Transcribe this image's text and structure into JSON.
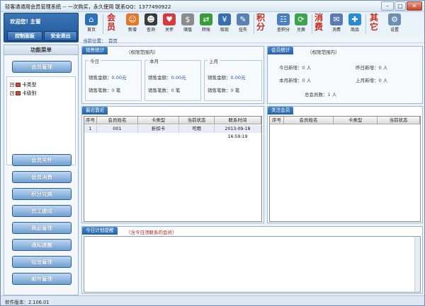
{
  "window": {
    "title": "轻客通通用会员管理系统 -- 一次购买，永久使用 联系QQ：1377490922",
    "min": "–",
    "max": "□",
    "close": "✕"
  },
  "welcome": {
    "text": "欢迎您! 主管",
    "control_panel": "控制面板",
    "logout": "安全退出"
  },
  "toolbar": {
    "items": [
      {
        "label": "首页",
        "icon": "home-icon",
        "glyph": "⌂",
        "color": "#2e6fb6"
      },
      {
        "label": "新增",
        "icon": "add-member-icon",
        "glyph": "☺",
        "color": "#e07a2a"
      },
      {
        "label": "查询",
        "icon": "search-member-icon",
        "glyph": "☻",
        "color": "#3b3b3b"
      },
      {
        "label": "关怀",
        "icon": "heart-icon",
        "glyph": "♥",
        "color": "#d63a3a"
      },
      {
        "label": "储值",
        "icon": "money-bag-icon",
        "glyph": "$",
        "color": "#8c8c8c"
      },
      {
        "label": "转账",
        "icon": "transfer-icon",
        "glyph": "⇄",
        "color": "#3a9a3a"
      },
      {
        "label": "取现",
        "icon": "cash-icon",
        "glyph": "¥",
        "color": "#3a6db0"
      },
      {
        "label": "挂失",
        "icon": "hammer-icon",
        "glyph": "✎",
        "color": "#5a82b0"
      },
      {
        "label": "查积分",
        "icon": "points-query-icon",
        "glyph": "☷",
        "color": "#4c7fc0"
      },
      {
        "label": "兑换",
        "icon": "exchange-icon",
        "glyph": "⟳",
        "color": "#3fa34d"
      },
      {
        "label": "消费",
        "icon": "consume-icon",
        "glyph": "✉",
        "color": "#5a7ab0"
      },
      {
        "label": "商品",
        "icon": "goods-icon",
        "glyph": "✚",
        "color": "#2e8ad0"
      },
      {
        "label": "设置",
        "icon": "settings-icon",
        "glyph": "⚙",
        "color": "#6b8fb5"
      }
    ],
    "groups": {
      "member": "会员",
      "points": "积分",
      "consume": "消费",
      "other": "其它"
    }
  },
  "breadcrumb": {
    "label": "当前位置：",
    "current": "首页"
  },
  "menu": {
    "title": "功能菜单",
    "member_mgmt": "会员管理",
    "tree": [
      {
        "label": "卡类型"
      },
      {
        "label": "卡级别"
      }
    ],
    "buttons": [
      "会员关怀",
      "会员消费",
      "积分兑换",
      "员工提成",
      "商品管理",
      "通知提醒",
      "短信管理",
      "邮件管理"
    ]
  },
  "sales": {
    "tab": "销售统计",
    "note": "（权限范围内）",
    "today": {
      "title": "今日",
      "amount_label": "销售金额：",
      "amount": "0.00元",
      "count_label": "销售笔数：",
      "count": "0",
      "count_unit": "笔"
    },
    "month": {
      "title": "本月",
      "amount_label": "销售金额：",
      "amount": "0.00元",
      "count_label": "销售笔数：",
      "count": "0",
      "count_unit": "笔"
    },
    "lastmonth": {
      "title": "上月",
      "amount_label": "销售金额：",
      "amount": "0.00元",
      "count_label": "销售笔数：",
      "count": "0",
      "count_unit": "笔"
    }
  },
  "member_stats": {
    "tab": "会员统计",
    "note": "（权限范围内）",
    "today_new_label": "今日新增：",
    "today_new": "0",
    "today_new_unit": "人",
    "yesterday_new_label": "昨日新增：",
    "yesterday_new": "0",
    "yesterday_new_unit": "人",
    "month_new_label": "本月新增：",
    "month_new": "0",
    "month_new_unit": "人",
    "lastmonth_new_label": "上月新增：",
    "lastmonth_new": "0",
    "lastmonth_new_unit": "人",
    "total_label": "总会员数：",
    "total": "1",
    "total_unit": "人"
  },
  "recent": {
    "tab": "最近靠近",
    "columns": [
      "序号",
      "会员姓名",
      "卡类型",
      "当前状态",
      "联系时间"
    ],
    "rows": [
      {
        "no": "1",
        "name": "001",
        "type": "折扣卡",
        "status": "可用",
        "time": "2013-09-18 16:59:19"
      }
    ]
  },
  "follow": {
    "tab": "关注会员",
    "columns": [
      "序号",
      "会员姓名",
      "卡类型",
      "当前状态"
    ]
  },
  "plan": {
    "tab": "今日计划提醒",
    "note": "（含今日须联系的会员）"
  },
  "status": {
    "version": "软件版本：2.106.01"
  }
}
